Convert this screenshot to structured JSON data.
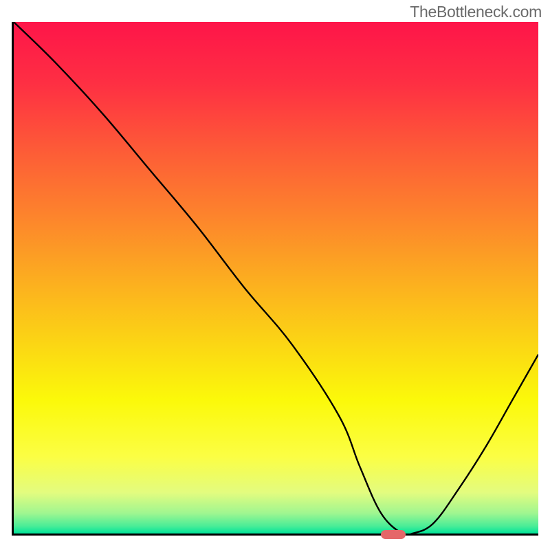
{
  "watermark": "TheBottleneck.com",
  "chart_data": {
    "type": "line",
    "title": "",
    "xlabel": "",
    "ylabel": "",
    "xlim": [
      0,
      100
    ],
    "ylim": [
      0,
      100
    ],
    "grid": false,
    "legend": false,
    "series": [
      {
        "name": "bottleneck-curve",
        "x": [
          0,
          8,
          17,
          26,
          35,
          44,
          53,
          62,
          66,
          70,
          74,
          76,
          80,
          85,
          90,
          95,
          100
        ],
        "values": [
          100,
          92,
          82,
          71,
          60,
          48,
          37,
          23,
          13,
          4,
          0,
          0,
          2,
          9,
          17,
          26,
          35
        ]
      }
    ],
    "marker": {
      "x": 72,
      "y": 0,
      "color": "#e56769"
    },
    "gradient_stops": [
      {
        "offset": 0.0,
        "color": "#fe1549"
      },
      {
        "offset": 0.12,
        "color": "#fe2f43"
      },
      {
        "offset": 0.25,
        "color": "#fd5b37"
      },
      {
        "offset": 0.38,
        "color": "#fd842c"
      },
      {
        "offset": 0.5,
        "color": "#fcac20"
      },
      {
        "offset": 0.62,
        "color": "#fbd315"
      },
      {
        "offset": 0.74,
        "color": "#fbf90a"
      },
      {
        "offset": 0.85,
        "color": "#fbfe44"
      },
      {
        "offset": 0.92,
        "color": "#e3fc7f"
      },
      {
        "offset": 0.96,
        "color": "#a0f690"
      },
      {
        "offset": 0.985,
        "color": "#4ced97"
      },
      {
        "offset": 1.0,
        "color": "#00e499"
      }
    ]
  }
}
